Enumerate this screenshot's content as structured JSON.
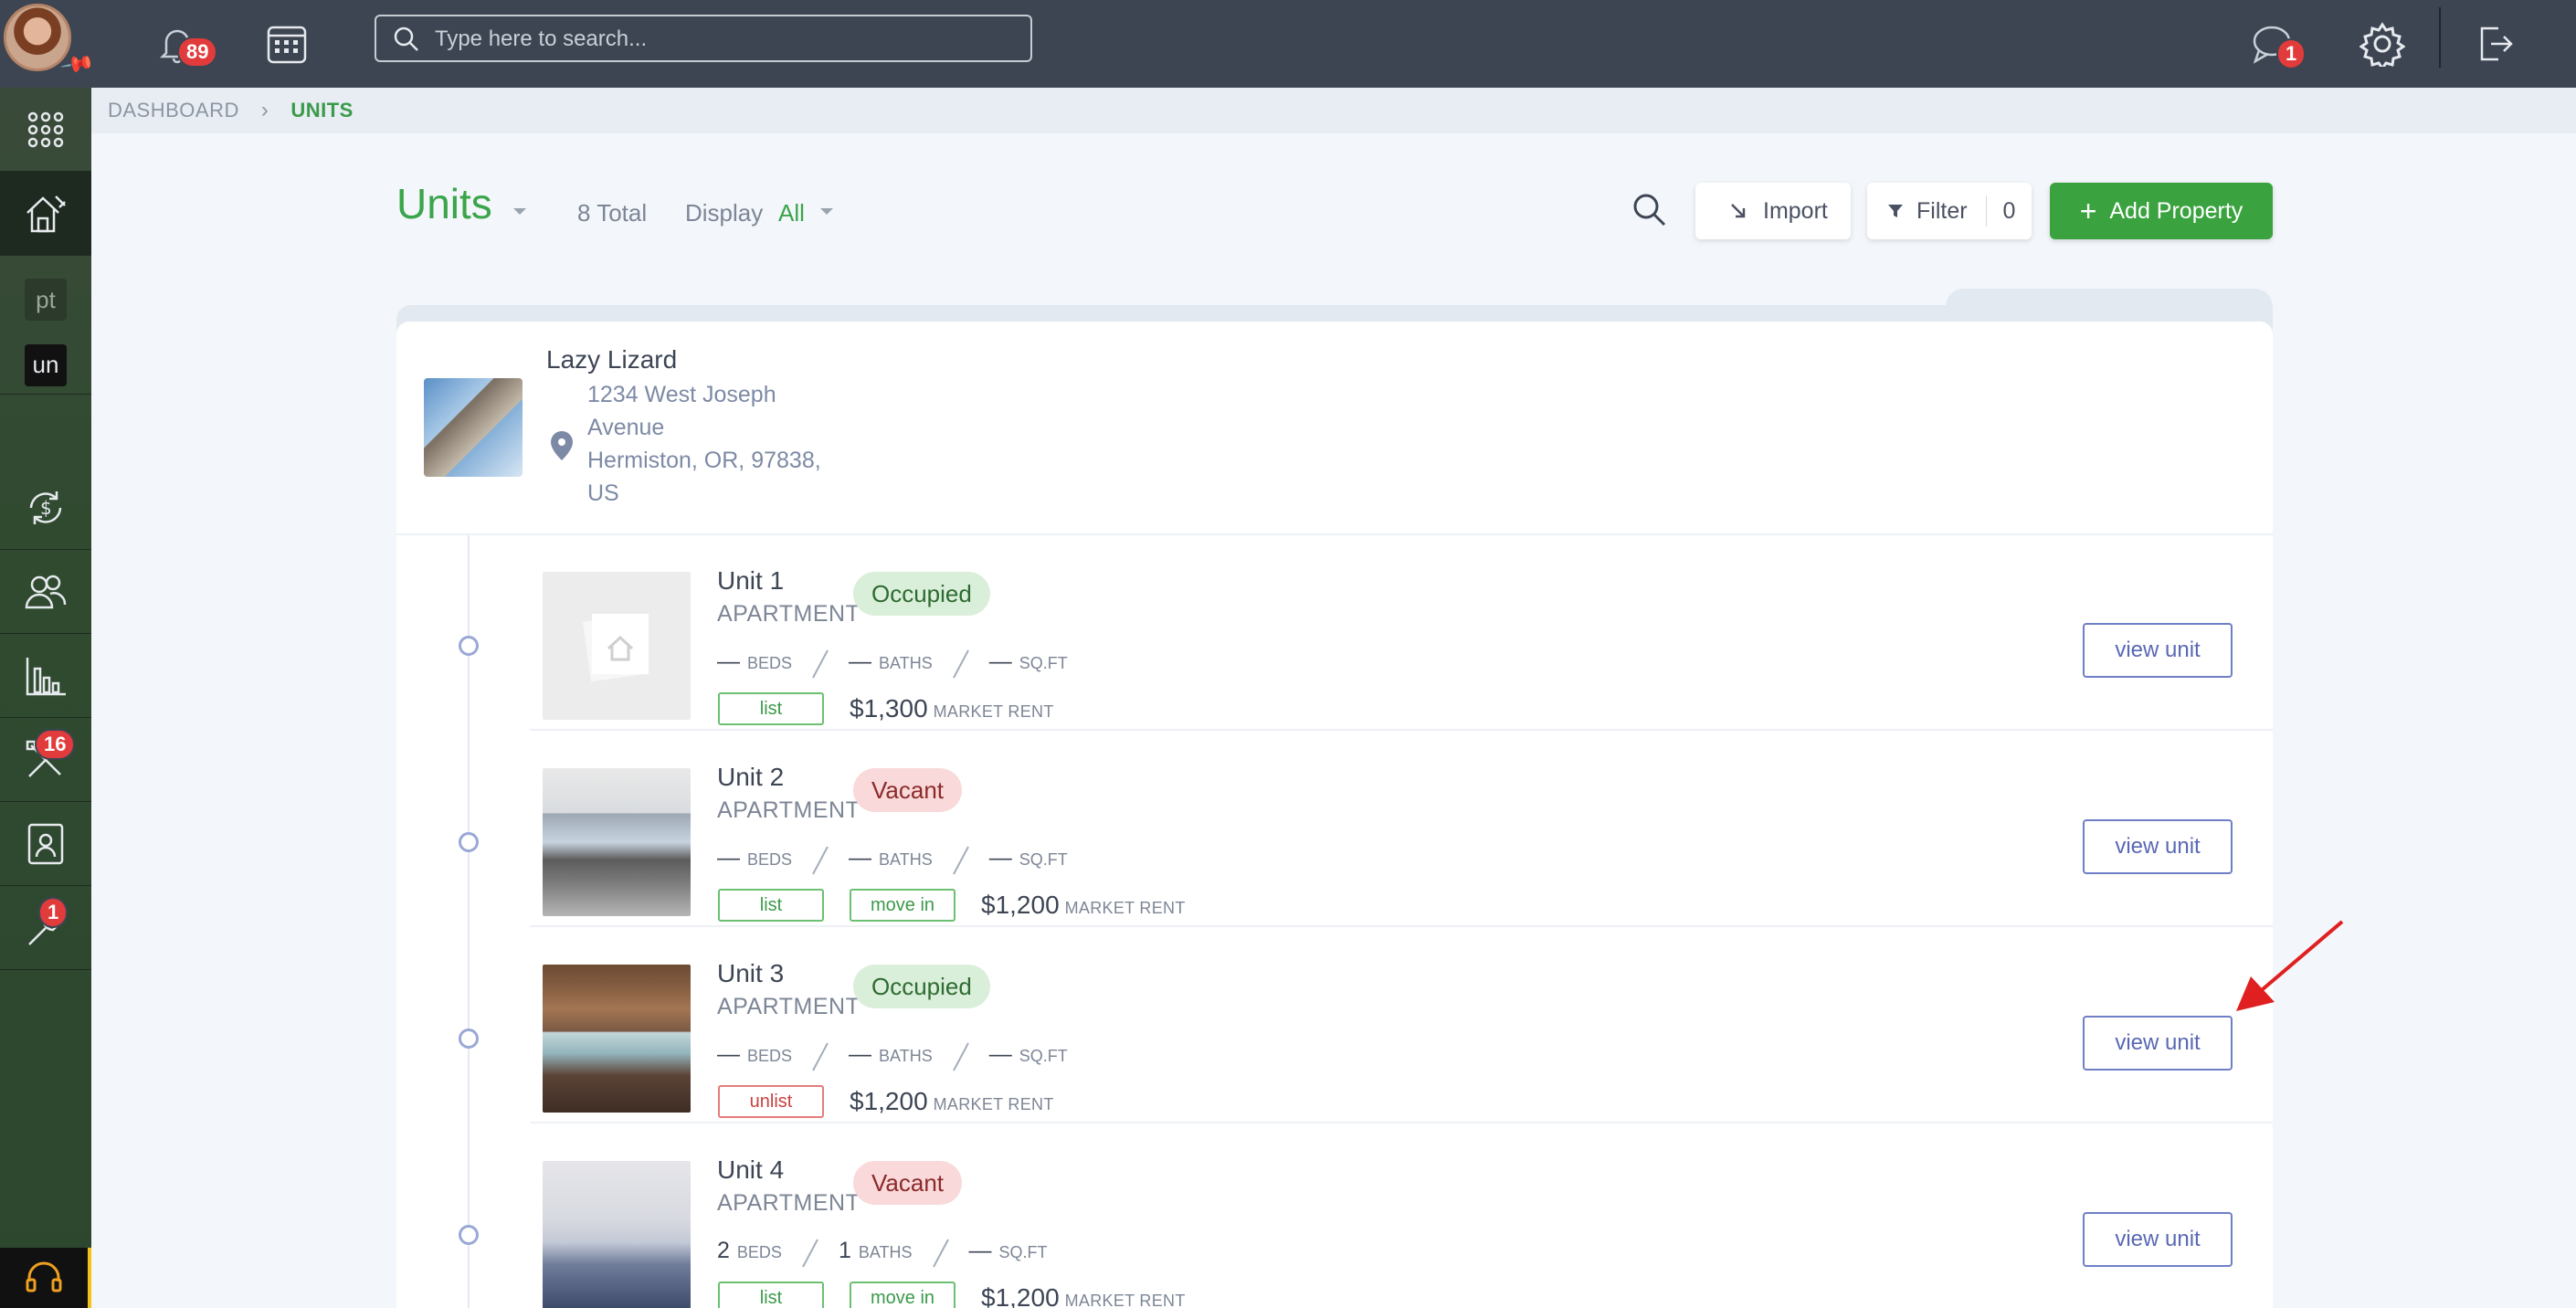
{
  "topbar": {
    "notifications_count": "89",
    "search_placeholder": "Type here to search...",
    "messages_count": "1"
  },
  "sidebar": {
    "badge_pt": "pt",
    "badge_un": "un",
    "maintenance_count": "16",
    "tools_count": "1"
  },
  "breadcrumb": {
    "root": "DASHBOARD",
    "current": "UNITS"
  },
  "header": {
    "title": "Units",
    "total": "8 Total",
    "display_label": "Display",
    "display_value": "All",
    "import_label": "Import",
    "filter_label": "Filter",
    "filter_count": "0",
    "add_label": "Add Property"
  },
  "property": {
    "name": "Lazy Lizard",
    "address_lines": [
      "1234 West Joseph",
      "Avenue",
      "Hermiston, OR, 97838,",
      "US"
    ]
  },
  "units": [
    {
      "name": "Unit 1",
      "type": "APARTMENT",
      "status": "Occupied",
      "beds": "—",
      "baths": "—",
      "sqft": "—",
      "beds_label": "BEDS",
      "baths_label": "BATHS",
      "sqft_label": "SQ.FT",
      "tags": [
        "list"
      ],
      "rent": "$1,300",
      "rent_label": "MARKET RENT",
      "action": "view unit"
    },
    {
      "name": "Unit 2",
      "type": "APARTMENT",
      "status": "Vacant",
      "beds": "—",
      "baths": "—",
      "sqft": "—",
      "beds_label": "BEDS",
      "baths_label": "BATHS",
      "sqft_label": "SQ.FT",
      "tags": [
        "list",
        "move in"
      ],
      "rent": "$1,200",
      "rent_label": "MARKET RENT",
      "action": "view unit"
    },
    {
      "name": "Unit 3",
      "type": "APARTMENT",
      "status": "Occupied",
      "beds": "—",
      "baths": "—",
      "sqft": "—",
      "beds_label": "BEDS",
      "baths_label": "BATHS",
      "sqft_label": "SQ.FT",
      "tags": [
        "unlist"
      ],
      "rent": "$1,200",
      "rent_label": "MARKET RENT",
      "action": "view unit"
    },
    {
      "name": "Unit 4",
      "type": "APARTMENT",
      "status": "Vacant",
      "beds": "2",
      "baths": "1",
      "sqft": "—",
      "beds_label": "BEDS",
      "baths_label": "BATHS",
      "sqft_label": "SQ.FT",
      "tags": [
        "list",
        "move in"
      ],
      "rent": "$1,200",
      "rent_label": "MARKET RENT",
      "action": "view unit"
    }
  ],
  "colors": {
    "accent_green": "#3aa54a",
    "topbar": "#3c4551",
    "badge_red": "#e23b3b",
    "view_button": "#5968b4"
  }
}
